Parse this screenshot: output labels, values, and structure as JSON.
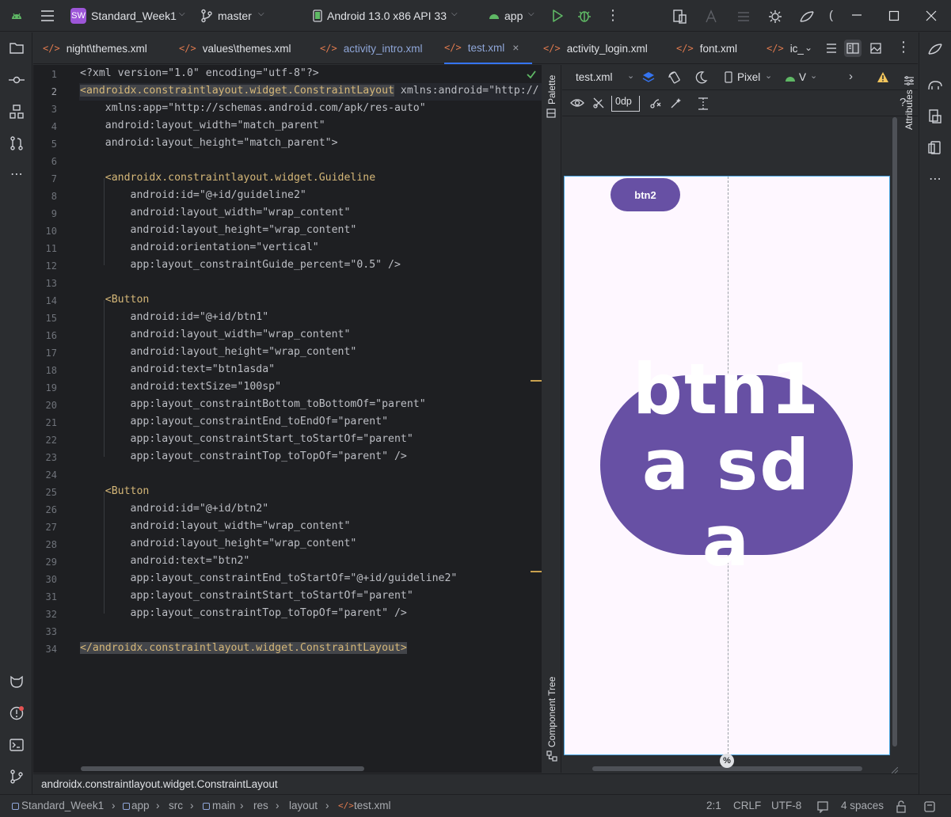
{
  "titlebar": {
    "project_badge": "SW",
    "project_name": "Standard_Week1",
    "branch": "master",
    "device": "Android 13.0 x86 API 33",
    "run_config": "app"
  },
  "tabs": [
    {
      "label": "night\\themes.xml"
    },
    {
      "label": "values\\themes.xml"
    },
    {
      "label": "activity_intro.xml"
    },
    {
      "label": "test.xml"
    },
    {
      "label": "activity_login.xml"
    },
    {
      "label": "font.xml"
    },
    {
      "label": "ic_"
    }
  ],
  "tab_marker": "</>",
  "editor": {
    "line_numbers": [
      "1",
      "2",
      "3",
      "4",
      "5",
      "6",
      "7",
      "8",
      "9",
      "10",
      "11",
      "12",
      "13",
      "14",
      "15",
      "16",
      "17",
      "18",
      "19",
      "20",
      "21",
      "22",
      "23",
      "24",
      "25",
      "26",
      "27",
      "28",
      "29",
      "30",
      "31",
      "32",
      "33",
      "34"
    ],
    "lines": {
      "l1": "<?xml version=\"1.0\" encoding=\"utf-8\"?>",
      "l2a": "<androidx.constraintlayout.widget.ConstraintLayout",
      "l2b": " xmlns:android=\"http://",
      "l3": "    xmlns:app=\"http://schemas.android.com/apk/res-auto\"",
      "l4": "    android:layout_width=\"match_parent\"",
      "l5": "    android:layout_height=\"match_parent\">",
      "l7": "    <androidx.constraintlayout.widget.Guideline",
      "l8": "        android:id=\"@+id/guideline2\"",
      "l9": "        android:layout_width=\"wrap_content\"",
      "l10": "        android:layout_height=\"wrap_content\"",
      "l11": "        android:orientation=\"vertical\"",
      "l12": "        app:layout_constraintGuide_percent=\"0.5\" />",
      "l14": "    <Button",
      "l15": "        android:id=\"@+id/btn1\"",
      "l16": "        android:layout_width=\"wrap_content\"",
      "l17": "        android:layout_height=\"wrap_content\"",
      "l18": "        android:text=\"btn1asda\"",
      "l19": "        android:textSize=\"100sp\"",
      "l20": "        app:layout_constraintBottom_toBottomOf=\"parent\"",
      "l21": "        app:layout_constraintEnd_toEndOf=\"parent\"",
      "l22": "        app:layout_constraintStart_toStartOf=\"parent\"",
      "l23": "        app:layout_constraintTop_toTopOf=\"parent\" />",
      "l25": "    <Button",
      "l26": "        android:id=\"@+id/btn2\"",
      "l27": "        android:layout_width=\"wrap_content\"",
      "l28": "        android:layout_height=\"wrap_content\"",
      "l29": "        android:text=\"btn2\"",
      "l30": "        app:layout_constraintEnd_toStartOf=\"@+id/guideline2\"",
      "l31": "        app:layout_constraintStart_toStartOf=\"parent\"",
      "l32": "        app:layout_constraintTop_toTopOf=\"parent\" />",
      "l34": "</androidx.constraintlayout.widget.ConstraintLayout>"
    }
  },
  "design": {
    "palette_label": "Palette",
    "component_tree_label": "Component Tree",
    "attributes_label": "Attributes",
    "file_selector": "test.xml",
    "device_selector": "Pixel",
    "api_selector": "V",
    "margin_value": "0dp",
    "help": "?",
    "preview": {
      "btn2_text": "btn2",
      "btn1_text": "btn1a sda",
      "guideline_percent_label": "%"
    }
  },
  "pathbar": {
    "component": "androidx.constraintlayout.widget.ConstraintLayout"
  },
  "statusbar": {
    "breadcrumb": [
      "Standard_Week1",
      "app",
      "src",
      "main",
      "res",
      "layout",
      "test.xml"
    ],
    "cursor": "2:1",
    "line_ending": "CRLF",
    "encoding": "UTF-8",
    "indent": "4 spaces"
  },
  "colors": {
    "accent": "#3574f0",
    "button_purple": "#6750a4",
    "device_bg": "#fef7ff",
    "warning": "#f2c55c"
  }
}
